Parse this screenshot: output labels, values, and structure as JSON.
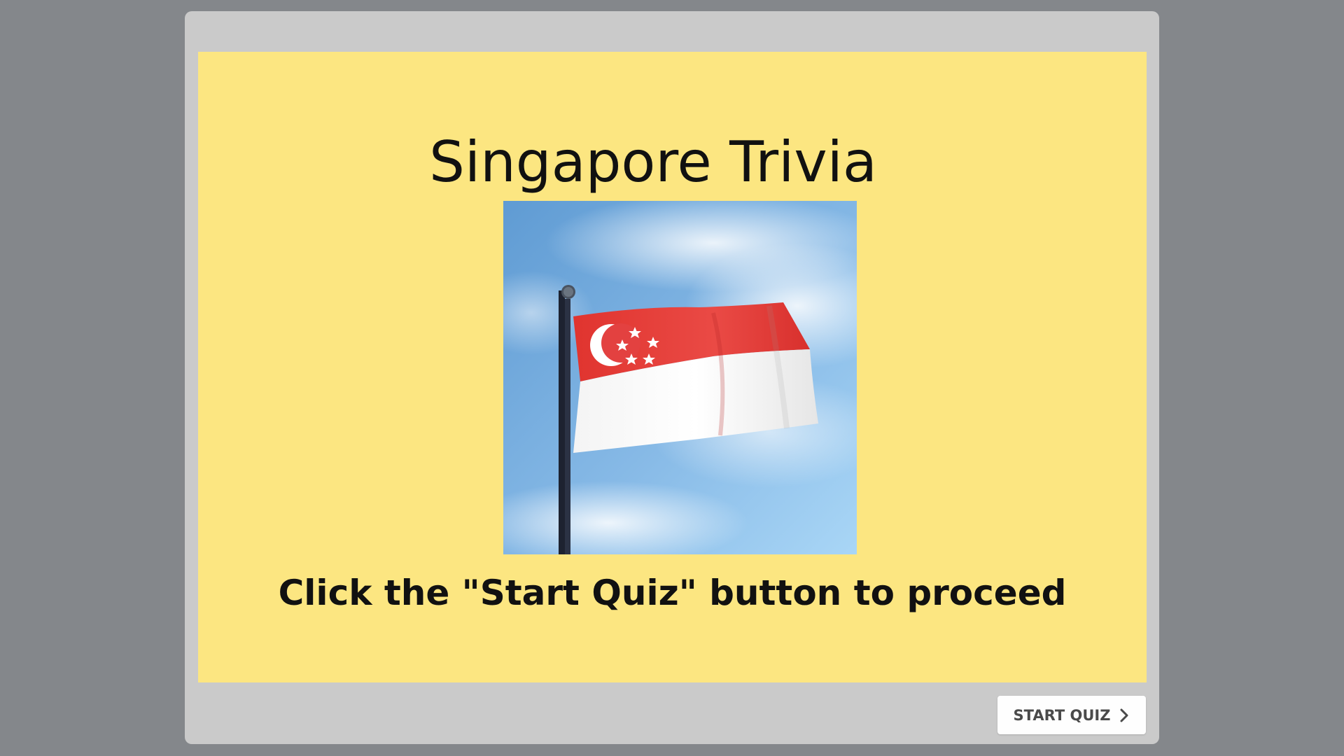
{
  "slide": {
    "title": "Singapore Trivia",
    "image_alt": "Singapore flag on a flagpole against a blue sky",
    "instruction": "Click the \"Start Quiz\" button to proceed",
    "background_color": "#fce681"
  },
  "controls": {
    "start_label": "START QUIZ",
    "start_icon": "chevron-right-icon"
  },
  "colors": {
    "page_background": "#84878b",
    "player_frame": "#cacaca",
    "flag_red": "#e53b3b",
    "flag_white": "#f4f4f4"
  }
}
